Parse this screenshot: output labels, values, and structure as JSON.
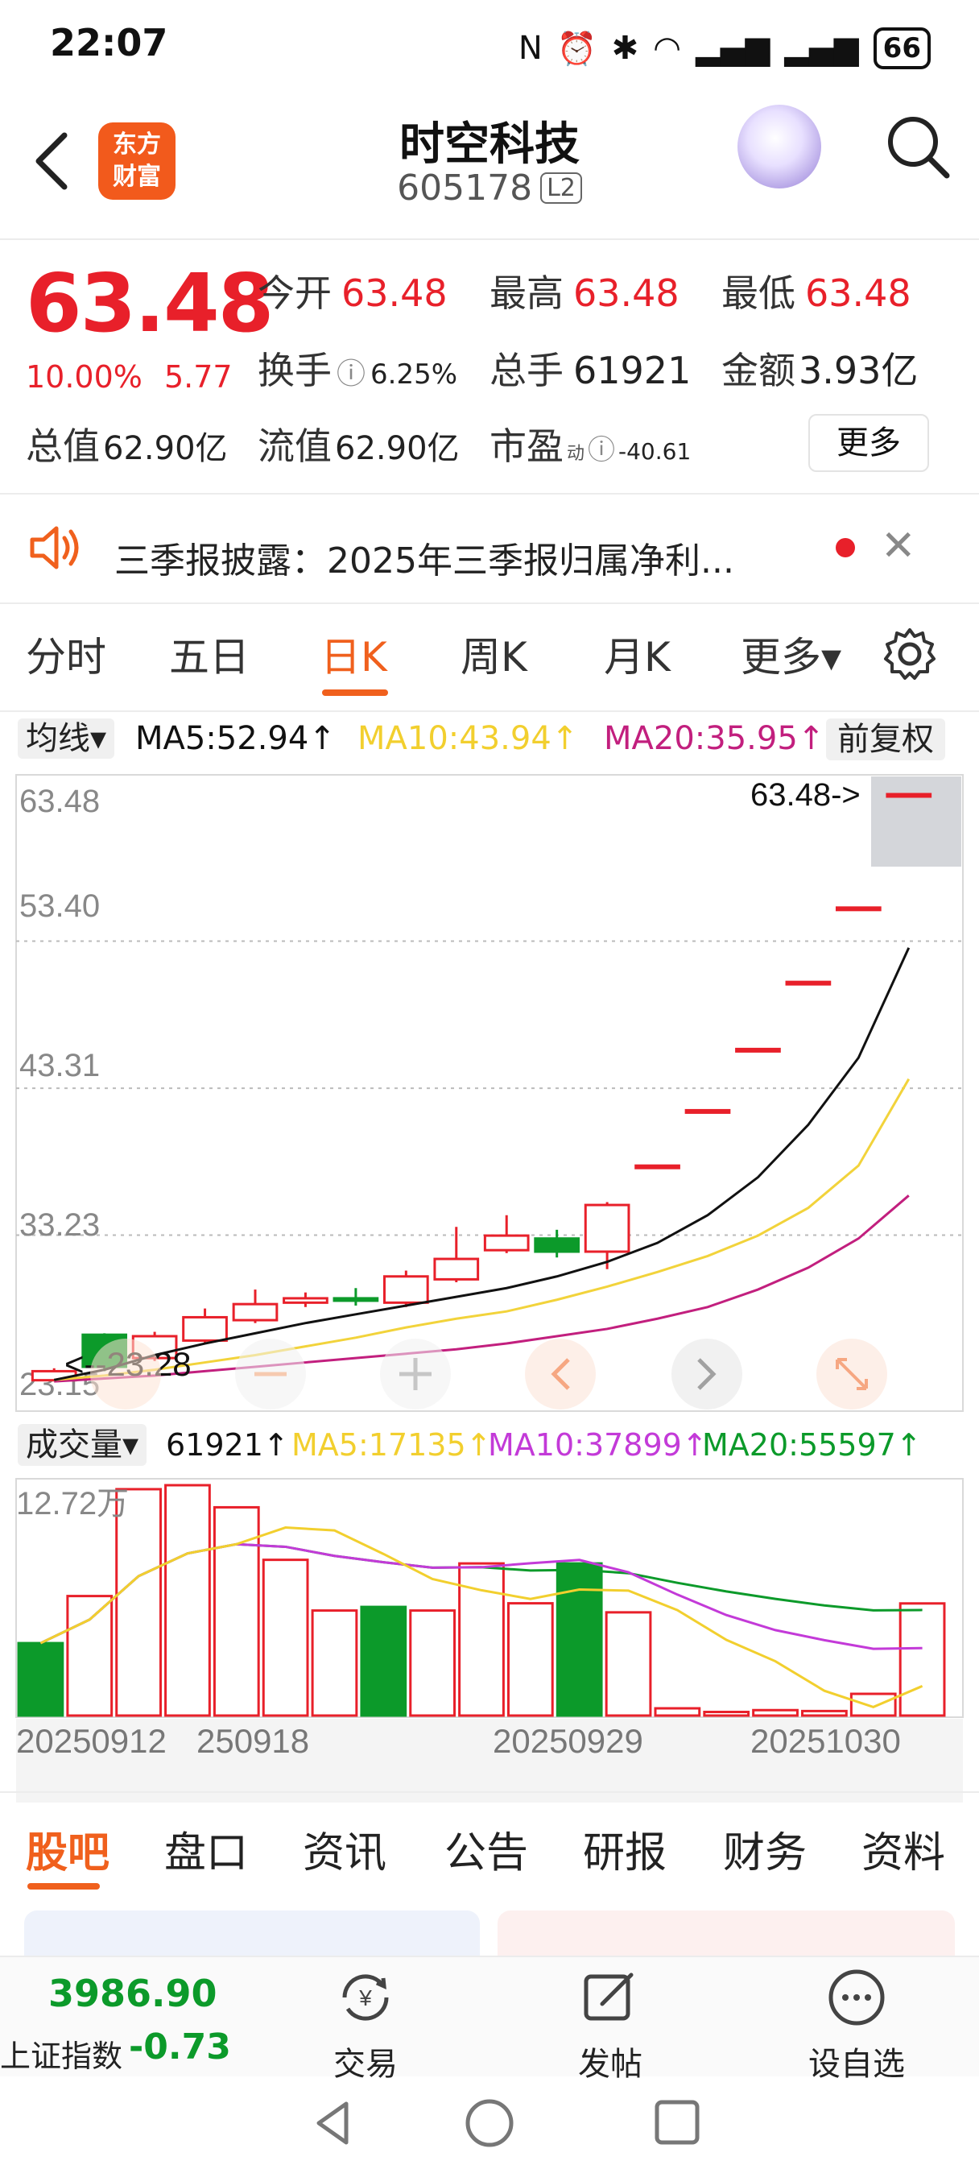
{
  "status": {
    "time": "22:07",
    "battery": "66"
  },
  "header": {
    "brand_line1": "东方",
    "brand_line2": "财富",
    "title": "时空科技",
    "code": "605178",
    "badge": "L2"
  },
  "quote": {
    "price": "63.48",
    "pct": "10.00%",
    "chg": "5.77",
    "open_label": "今开",
    "open_val": "63.48",
    "high_label": "最高",
    "high_val": "63.48",
    "low_label": "最低",
    "low_val": "63.48",
    "turnover_label": "换手",
    "turnover_val": "6.25%",
    "volume_label": "总手",
    "volume_val": "61921",
    "amount_label": "金额",
    "amount_val": "3.93亿",
    "mktcap_label": "总值",
    "mktcap_val": "62.90亿",
    "float_label": "流值",
    "float_val": "62.90亿",
    "pe_label": "市盈",
    "pe_sup": "动",
    "pe_val": "-40.61",
    "more": "更多"
  },
  "notice": {
    "text": "三季报披露：2025年三季报归属净利..."
  },
  "period_tabs": [
    "分时",
    "五日",
    "日K",
    "周K",
    "月K",
    "更多▾"
  ],
  "ma_bar": {
    "select": "均线▾",
    "ma5": "MA5:52.94↑",
    "ma10": "MA10:43.94↑",
    "ma20": "MA20:35.95↑",
    "fuquan": "前复权"
  },
  "kline": {
    "y_labels": [
      "63.48",
      "53.40",
      "43.31",
      "33.23",
      "23.15"
    ],
    "max_annot": "63.48->",
    "min_annot": "<--23.28"
  },
  "volume_bar": {
    "select": "成交量▾",
    "vol": "61921↑",
    "ma5": "MA5:17135↑",
    "ma10": "MA10:37899↑",
    "ma20": "MA20:55597↑",
    "ylabel": "12.72万"
  },
  "x_labels": [
    "20250912",
    "250918",
    "20250929",
    "20251030"
  ],
  "info_tabs": [
    "股吧",
    "盘口",
    "资讯",
    "公告",
    "研报",
    "财务",
    "资料"
  ],
  "bottom": {
    "index_value": "3986.90",
    "index_name": "上证指数",
    "index_chg": "-0.73",
    "trade": "交易",
    "post": "发帖",
    "watch": "设自选"
  },
  "colors": {
    "up": "#e8202a",
    "down": "#0c9a2a",
    "accent": "#f0601d",
    "ma5": "#111111",
    "ma10": "#f2d33b",
    "ma20": "#c21f7e"
  },
  "chart_data": {
    "type": "candlestick",
    "candles": [
      {
        "o": 23.28,
        "c": 23.9,
        "h": 24.1,
        "l": 23.28
      },
      {
        "o": 26.4,
        "c": 24.2,
        "h": 26.5,
        "l": 23.9
      },
      {
        "o": 24.8,
        "c": 26.3,
        "h": 26.6,
        "l": 24.6
      },
      {
        "o": 26.0,
        "c": 27.6,
        "h": 28.2,
        "l": 25.8
      },
      {
        "o": 27.4,
        "c": 28.5,
        "h": 29.5,
        "l": 27.2
      },
      {
        "o": 28.6,
        "c": 28.9,
        "h": 29.3,
        "l": 28.3
      },
      {
        "o": 28.9,
        "c": 28.8,
        "h": 29.6,
        "l": 28.4
      },
      {
        "o": 28.6,
        "c": 30.4,
        "h": 30.8,
        "l": 28.3
      },
      {
        "o": 30.2,
        "c": 31.6,
        "h": 33.8,
        "l": 30.0
      },
      {
        "o": 32.2,
        "c": 33.2,
        "h": 34.6,
        "l": 32.0
      },
      {
        "o": 33.0,
        "c": 32.1,
        "h": 33.6,
        "l": 31.7
      },
      {
        "o": 32.1,
        "c": 35.3,
        "h": 35.5,
        "l": 30.9
      },
      {
        "o": 38.0,
        "c": 38.0,
        "h": 38.0,
        "l": 38.0
      },
      {
        "o": 41.8,
        "c": 41.8,
        "h": 41.8,
        "l": 41.8
      },
      {
        "o": 46.0,
        "c": 46.0,
        "h": 46.0,
        "l": 46.0
      },
      {
        "o": 50.6,
        "c": 50.6,
        "h": 50.6,
        "l": 50.6
      },
      {
        "o": 55.7,
        "c": 55.7,
        "h": 55.7,
        "l": 55.7
      },
      {
        "o": 63.48,
        "c": 63.48,
        "h": 63.48,
        "l": 63.48
      }
    ],
    "ma5": [
      23.3,
      24.0,
      25.0,
      25.8,
      26.5,
      27.2,
      27.8,
      28.4,
      29.0,
      29.6,
      30.4,
      31.4,
      32.7,
      34.6,
      37.2,
      40.8,
      45.4,
      52.94
    ],
    "ma10": [
      23.3,
      23.6,
      24.0,
      24.5,
      25.0,
      25.6,
      26.2,
      26.9,
      27.5,
      28.0,
      28.8,
      29.7,
      30.7,
      31.8,
      33.2,
      35.1,
      38.0,
      43.94
    ],
    "ma20": [
      23.2,
      23.4,
      23.6,
      23.9,
      24.2,
      24.5,
      24.8,
      25.1,
      25.4,
      25.8,
      26.3,
      26.8,
      27.5,
      28.3,
      29.5,
      31.0,
      33.0,
      35.95
    ],
    "ylim": [
      23.15,
      63.48
    ],
    "volume": [
      40000,
      66000,
      125000,
      127200,
      115000,
      86000,
      58000,
      60000,
      58000,
      84000,
      62000,
      84000,
      57000,
      4000,
      2000,
      3000,
      2500,
      12000,
      61921
    ],
    "volume_up": [
      false,
      true,
      true,
      true,
      true,
      true,
      true,
      false,
      true,
      true,
      true,
      false,
      true,
      true,
      true,
      true,
      true,
      true,
      true
    ]
  }
}
